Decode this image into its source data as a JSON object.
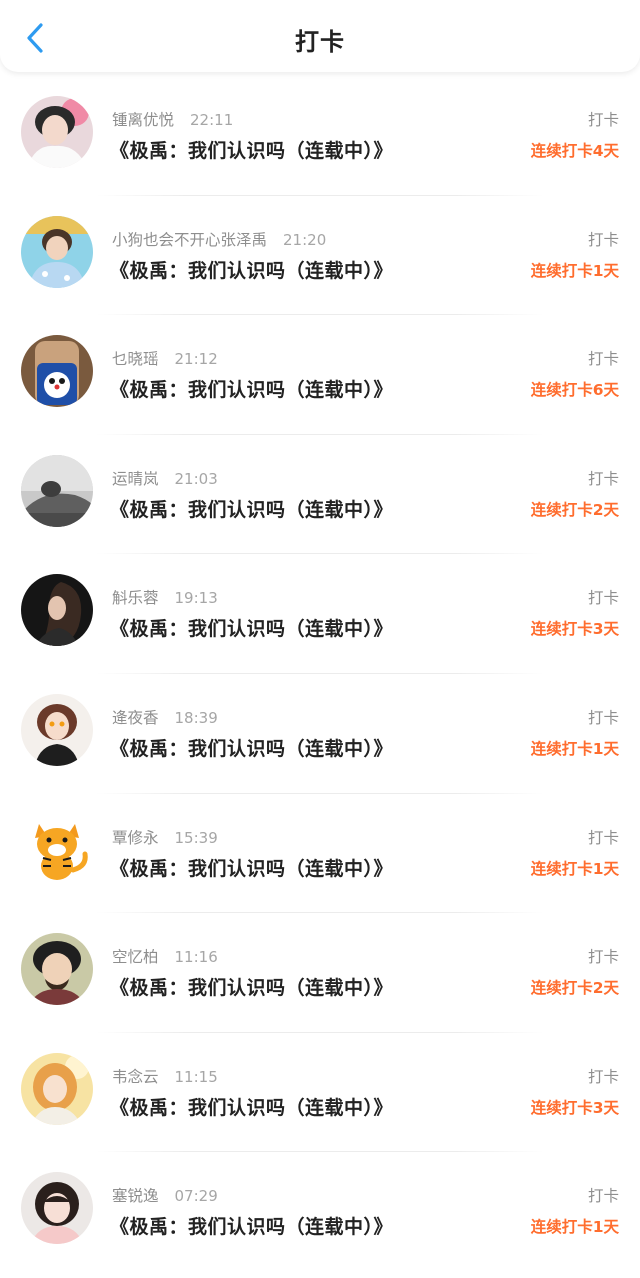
{
  "header": {
    "title": "打卡",
    "back_icon": "chevron-left-icon",
    "accent_color": "#2e9bf0"
  },
  "streak_color": "#ff6d2e",
  "entries": [
    {
      "name": "锺离优悦",
      "time": "22:11",
      "book": "《极禹：我们认识吗（连载中）》",
      "action": "打卡",
      "streak": "连续打卡4天"
    },
    {
      "name": "小狗也会不开心张泽禹",
      "time": "21:20",
      "book": "《极禹：我们认识吗（连载中）》",
      "action": "打卡",
      "streak": "连续打卡1天"
    },
    {
      "name": "乜晓瑶",
      "time": "21:12",
      "book": "《极禹：我们认识吗（连载中）》",
      "action": "打卡",
      "streak": "连续打卡6天"
    },
    {
      "name": "运晴岚",
      "time": "21:03",
      "book": "《极禹：我们认识吗（连载中）》",
      "action": "打卡",
      "streak": "连续打卡2天"
    },
    {
      "name": "斛乐蓉",
      "time": "19:13",
      "book": "《极禹：我们认识吗（连载中）》",
      "action": "打卡",
      "streak": "连续打卡3天"
    },
    {
      "name": "逄夜香",
      "time": "18:39",
      "book": "《极禹：我们认识吗（连载中）》",
      "action": "打卡",
      "streak": "连续打卡1天"
    },
    {
      "name": "覃修永",
      "time": "15:39",
      "book": "《极禹：我们认识吗（连载中）》",
      "action": "打卡",
      "streak": "连续打卡1天"
    },
    {
      "name": "空忆柏",
      "time": "11:16",
      "book": "《极禹：我们认识吗（连载中）》",
      "action": "打卡",
      "streak": "连续打卡2天"
    },
    {
      "name": "韦念云",
      "time": "11:15",
      "book": "《极禹：我们认识吗（连载中）》",
      "action": "打卡",
      "streak": "连续打卡3天"
    },
    {
      "name": "塞锐逸",
      "time": "07:29",
      "book": "《极禹：我们认识吗（连载中）》",
      "action": "打卡",
      "streak": "连续打卡1天"
    }
  ]
}
